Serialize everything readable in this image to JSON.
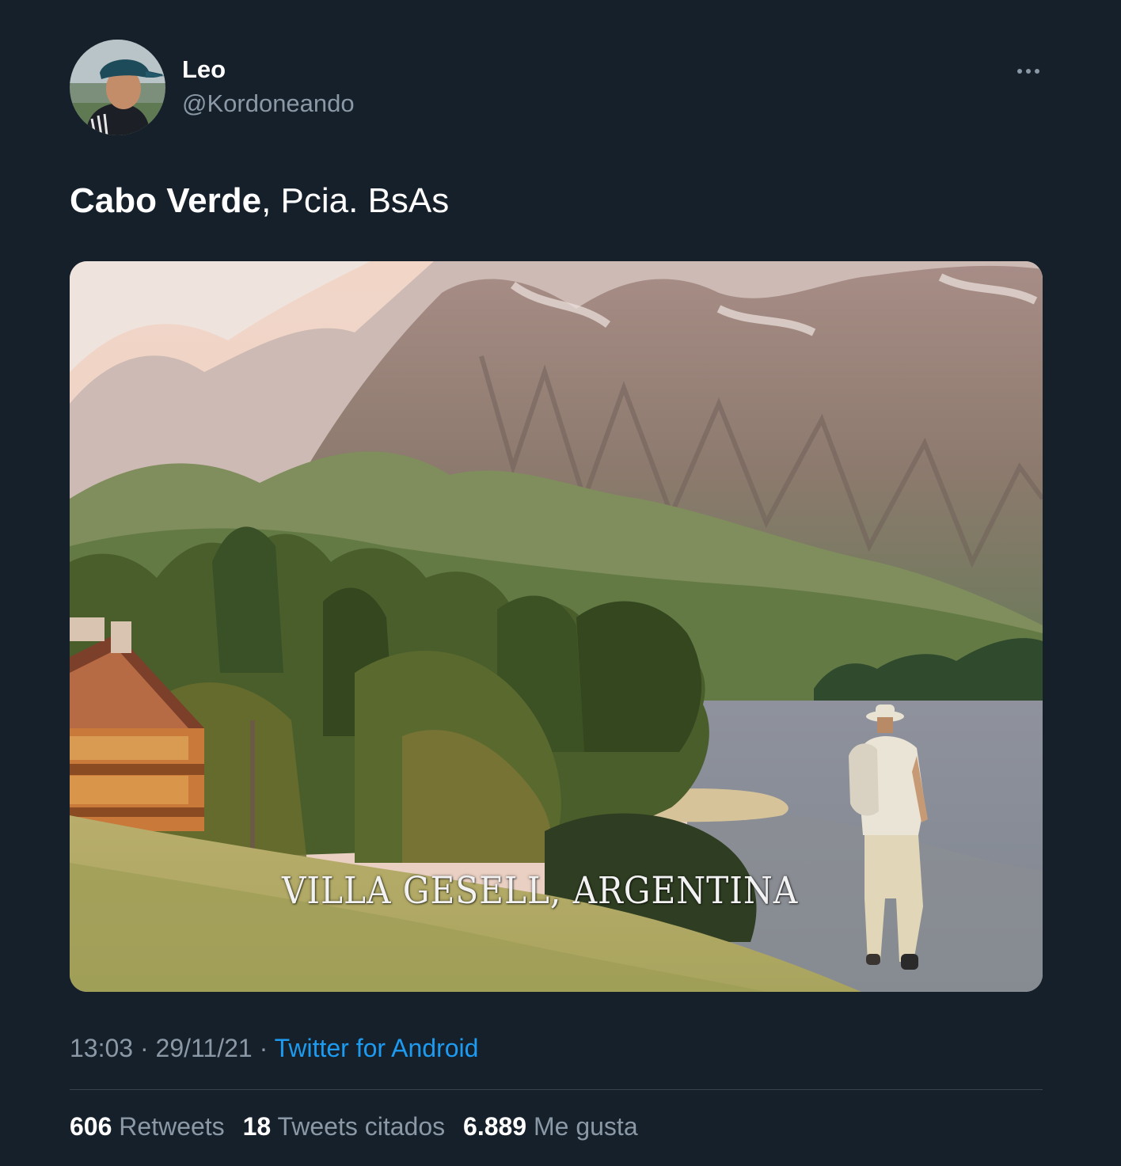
{
  "user": {
    "name": "Leo",
    "handle": "@Kordoneando"
  },
  "tweet": {
    "text_bold": "Cabo Verde",
    "text_rest": ", Pcia. BsAs"
  },
  "media": {
    "caption": "VILLA GESELL, ARGENTINA"
  },
  "meta": {
    "time": "13:03",
    "separator": " · ",
    "date": "29/11/21",
    "source": "Twitter for Android"
  },
  "stats": {
    "retweets_count": "606",
    "retweets_label": "Retweets",
    "quotes_count": "18",
    "quotes_label": "Tweets citados",
    "likes_count": "6.889",
    "likes_label": "Me gusta"
  },
  "icons": {
    "more": "more-horizontal-icon"
  },
  "colors": {
    "background": "#15202b",
    "text_primary": "#ffffff",
    "text_secondary": "#8b98a5",
    "link": "#1d9bf0",
    "divider": "#38444d"
  }
}
